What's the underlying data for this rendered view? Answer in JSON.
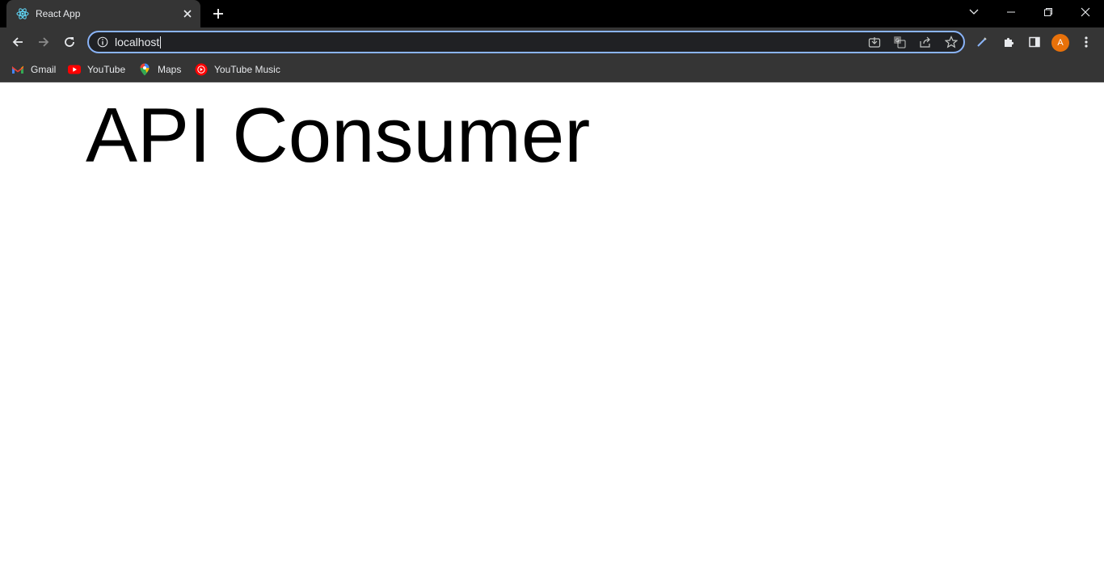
{
  "browser": {
    "tab": {
      "title": "React App",
      "favicon": "react-logo-icon"
    },
    "address_bar": {
      "url": "localhost"
    },
    "profile_initial": "A",
    "bookmarks": [
      {
        "label": "Gmail",
        "icon": "gmail-icon"
      },
      {
        "label": "YouTube",
        "icon": "youtube-icon"
      },
      {
        "label": "Maps",
        "icon": "maps-icon"
      },
      {
        "label": "YouTube Music",
        "icon": "youtube-music-icon"
      }
    ]
  },
  "page": {
    "heading": "API Consumer"
  },
  "colors": {
    "tabstrip_bg": "#000000",
    "toolbar_bg": "#353535",
    "omnibox_bg": "#202124",
    "focus_ring": "#8ab4f8",
    "avatar": "#e8710a",
    "page_bg": "#ffffff"
  }
}
